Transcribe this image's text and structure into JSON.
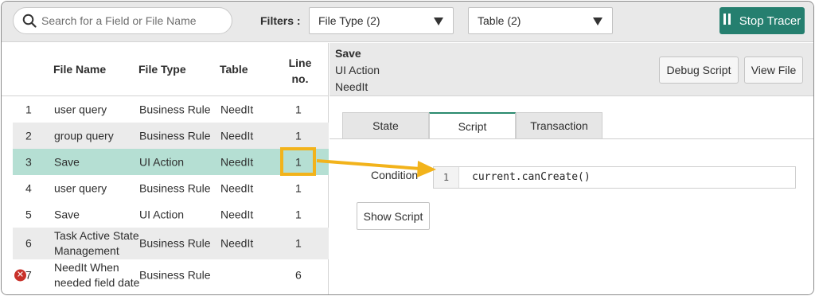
{
  "search": {
    "placeholder": "Search for a Field or File Name"
  },
  "filters": {
    "label": "Filters :",
    "file_type": "File Type (2)",
    "table": "Table (2)"
  },
  "stop_tracer": {
    "label": "Stop Tracer"
  },
  "columns": {
    "file_name": "File Name",
    "file_type": "File Type",
    "table": "Table",
    "line_no_1": "Line",
    "line_no_2": "no."
  },
  "rows": [
    {
      "num": "1",
      "name": "user query",
      "type": "Business Rule",
      "table": "NeedIt",
      "line": "1"
    },
    {
      "num": "2",
      "name": "group query",
      "type": "Business Rule",
      "table": "NeedIt",
      "line": "1"
    },
    {
      "num": "3",
      "name": "Save",
      "type": "UI Action",
      "table": "NeedIt",
      "line": "1"
    },
    {
      "num": "4",
      "name": "user query",
      "type": "Business Rule",
      "table": "NeedIt",
      "line": "1"
    },
    {
      "num": "5",
      "name": "Save",
      "type": "UI Action",
      "table": "NeedIt",
      "line": "1"
    },
    {
      "num": "6",
      "name": "Task Active State Management",
      "type": "Business Rule",
      "table": "NeedIt",
      "line": "1"
    },
    {
      "num": "7",
      "name": "NeedIt When needed field date",
      "type": "Business Rule",
      "table": "",
      "line": "6"
    }
  ],
  "details": {
    "title": "Save",
    "subtitle1": "UI Action",
    "subtitle2": "NeedIt",
    "debug_label": "Debug Script",
    "view_label": "View File"
  },
  "tabs": {
    "state": "State",
    "script": "Script",
    "transaction": "Transaction"
  },
  "script": {
    "condition_label": "Condition",
    "line_number": "1",
    "code": "current.canCreate()",
    "show_label": "Show Script"
  },
  "colors": {
    "accent": "#257f6f",
    "selected_row": "#b5dfd3",
    "highlight": "#f2b31b",
    "error": "#c8312a"
  },
  "icons": {
    "search": "search-icon",
    "pause": "pause-icon",
    "error": "error-x-icon",
    "caret": "caret-down-icon"
  }
}
